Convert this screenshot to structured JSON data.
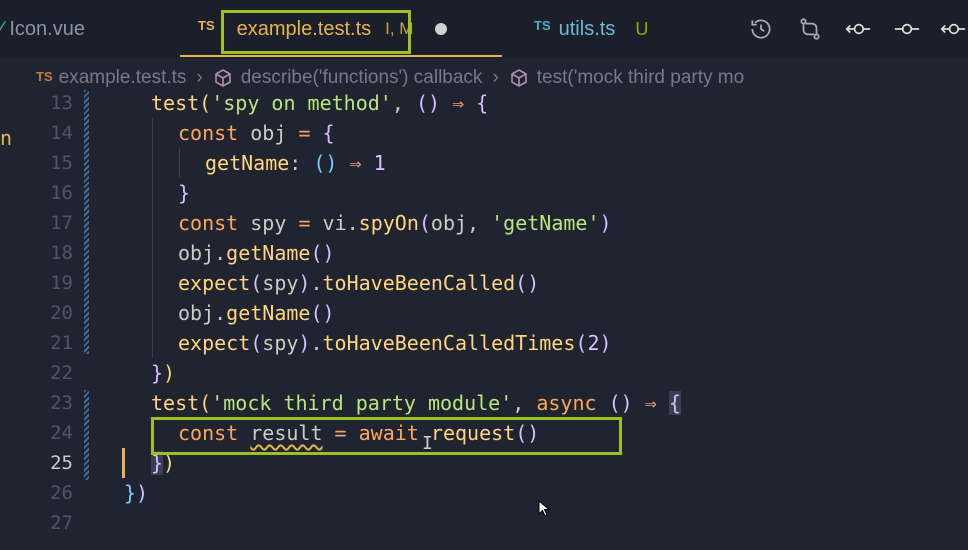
{
  "tabs": [
    {
      "label": "Icon.vue"
    },
    {
      "lang": "TS",
      "label": "example.test.ts",
      "status": "I, M"
    },
    {
      "lang": "TS",
      "label": "utils.ts",
      "status": "U"
    }
  ],
  "breadcrumb": {
    "lang": "TS",
    "file": "example.test.ts",
    "item1": "describe('functions') callback",
    "item2": "test('mock third party mo"
  },
  "gutter_left_char": "n",
  "lines": [
    {
      "n": "13"
    },
    {
      "n": "14"
    },
    {
      "n": "15"
    },
    {
      "n": "16"
    },
    {
      "n": "17"
    },
    {
      "n": "18"
    },
    {
      "n": "19"
    },
    {
      "n": "20"
    },
    {
      "n": "21"
    },
    {
      "n": "22"
    },
    {
      "n": "23"
    },
    {
      "n": "24"
    },
    {
      "n": "25"
    },
    {
      "n": "26"
    },
    {
      "n": "27"
    }
  ],
  "code": {
    "l13": {
      "a": "test",
      "b": "(",
      "c": "'spy on method'",
      "d": ", ",
      "e": "()",
      "f": " ⇒ ",
      "g": "{"
    },
    "l14": {
      "a": "const",
      "b": " obj ",
      "c": "=",
      "d": " {"
    },
    "l15": {
      "a": "getName",
      "b": ": ",
      "c": "()",
      "d": " ⇒ ",
      "e": "1"
    },
    "l16": {
      "a": "}"
    },
    "l17": {
      "a": "const",
      "b": " spy ",
      "c": "=",
      "d": " vi.",
      "e": "spyOn",
      "f": "(",
      "g": "obj, ",
      "h": "'getName'",
      "i": ")"
    },
    "l18": {
      "a": "obj.",
      "b": "getName",
      "c": "()"
    },
    "l19": {
      "a": "expect",
      "b": "(",
      "c": "spy",
      "d": ").",
      "e": "toHaveBeenCalled",
      "f": "()"
    },
    "l20": {
      "a": "obj.",
      "b": "getName",
      "c": "()"
    },
    "l21": {
      "a": "expect",
      "b": "(",
      "c": "spy",
      "d": ").",
      "e": "toHaveBeenCalledTimes",
      "f": "(",
      "g": "2",
      "h": ")"
    },
    "l22": {
      "a": "}",
      "b": ")"
    },
    "l23": {
      "a": "test",
      "b": "(",
      "c": "'mock third party module'",
      "d": ", ",
      "e": "async",
      "f": " ",
      "g": "()",
      "h": " ⇒ ",
      "i": "{"
    },
    "l24": {
      "a": "const",
      "b": " ",
      "c": "result",
      "d": " = ",
      "e": "await",
      "f": " ",
      "g": "request",
      "h": "()"
    },
    "l25": {
      "a": "}",
      "b": ")"
    },
    "l26": {
      "a": "}",
      "b": ")"
    }
  },
  "colors": {
    "accent": "#e6b450",
    "highlight": "#9cc31d",
    "background": "#1f2430"
  }
}
